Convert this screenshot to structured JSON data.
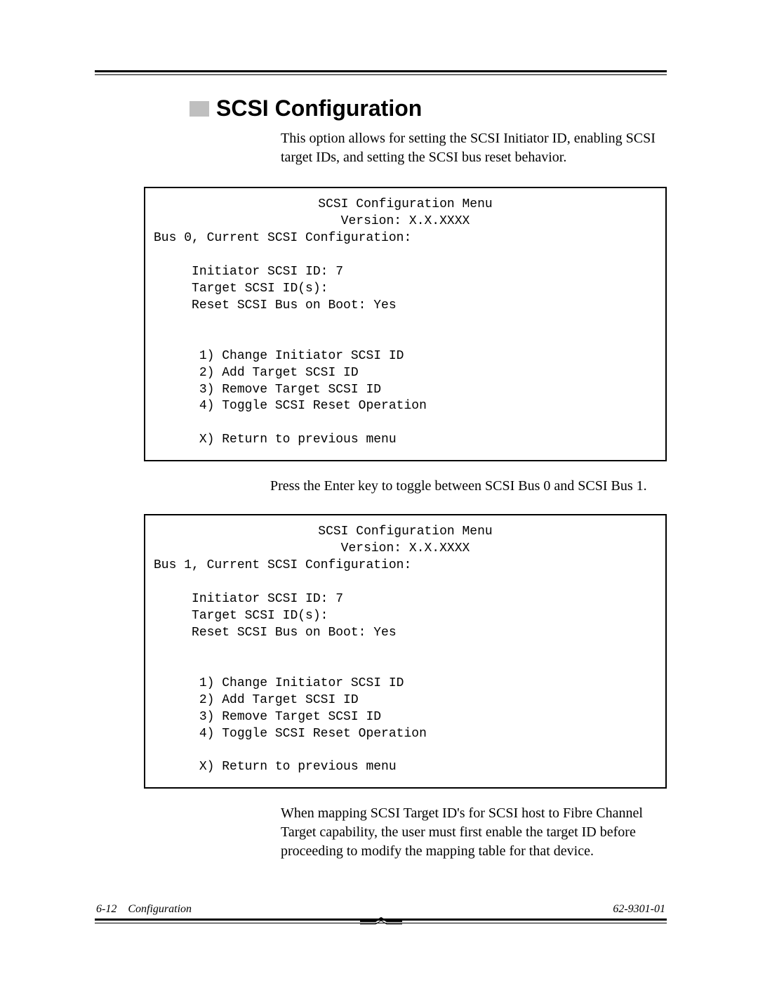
{
  "heading": "SCSI Configuration",
  "intro": "This option allows for setting the SCSI Initiator ID, enabling SCSI target IDs, and setting the SCSI bus reset behavior.",
  "menu_title": "SCSI Configuration Menu",
  "menu_version": "Version: X.X.XXXX",
  "bus0_header": "Bus 0, Current SCSI Configuration:",
  "bus1_header": "Bus 1, Current SCSI Configuration:",
  "cfg_initiator": "Initiator SCSI ID: 7",
  "cfg_target": "Target SCSI ID(s):",
  "cfg_reset": "Reset SCSI Bus on Boot: Yes",
  "opt1": "1) Change Initiator SCSI ID",
  "opt2": "2) Add Target SCSI ID",
  "opt3": "3) Remove Target SCSI ID",
  "opt4": "4) Toggle SCSI Reset Operation",
  "optX": "X) Return to previous menu",
  "mid_para": "Press the Enter key to toggle between SCSI Bus 0 and SCSI Bus 1.",
  "end_para": "When mapping SCSI Target ID's for SCSI host to Fibre Channel Target capability, the user must first enable the target ID before proceeding to modify the mapping table for that device.",
  "footer_left": "6-12 Configuration",
  "footer_right": "62-9301-01"
}
